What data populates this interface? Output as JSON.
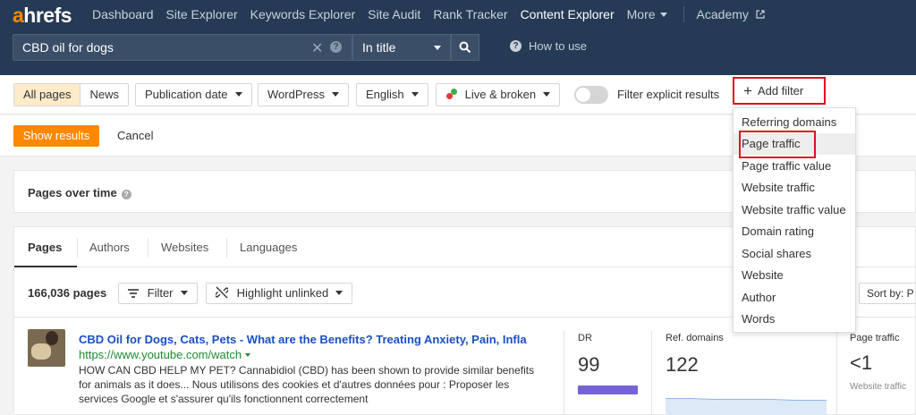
{
  "nav": {
    "logo_a": "a",
    "logo_rest": "hrefs",
    "items": [
      "Dashboard",
      "Site Explorer",
      "Keywords Explorer",
      "Site Audit",
      "Rank Tracker",
      "Content Explorer",
      "More",
      "Academy"
    ],
    "active": "Content Explorer"
  },
  "search": {
    "value": "CBD oil for dogs",
    "mode": "In title",
    "how_to": "How to use"
  },
  "filters": {
    "all_pages": "All pages",
    "news": "News",
    "publication_date": "Publication date",
    "platform": "WordPress",
    "language": "English",
    "live_broken": "Live & broken",
    "explicit_label": "Filter explicit results",
    "explicit_on": false,
    "add_filter": "Add filter"
  },
  "actions": {
    "show_results": "Show results",
    "cancel": "Cancel"
  },
  "pages_over_time": {
    "title": "Pages over time"
  },
  "tabs": [
    "Pages",
    "Authors",
    "Websites",
    "Languages"
  ],
  "results": {
    "count": "166,036 pages",
    "filter": "Filter",
    "highlight": "Highlight unlinked",
    "sort": "Sort by: P",
    "items": [
      {
        "title": "CBD Oil for Dogs, Cats, Pets - What are the Benefits? Treating Anxiety, Pain, Infla",
        "url": "https://www.youtube.com/watch",
        "desc": "HOW CAN CBD HELP MY PET? Cannabidiol (CBD) has been shown to provide similar benefits for animals as it does... Nous utilisons des cookies et d'autres données pour : Proposer les services Google et s'assurer qu'ils fonctionnent correctement",
        "dr_label": "DR",
        "dr": "99",
        "ref_label": "Ref. domains",
        "ref": "122",
        "traffic_label": "Page traffic",
        "traffic": "<1",
        "traffic_sub": "Website traffic"
      }
    ]
  },
  "menu": {
    "items": [
      "Referring domains",
      "Page traffic",
      "Page traffic value",
      "Website traffic",
      "Website traffic value",
      "Domain rating",
      "Social shares",
      "Website",
      "Author",
      "Words"
    ],
    "hovered": "Page traffic"
  },
  "colors": {
    "accent": "#ff8800",
    "nav_bg": "#253a54",
    "highlight_border": "#e0101f",
    "dr_bar": "#7563d6"
  }
}
